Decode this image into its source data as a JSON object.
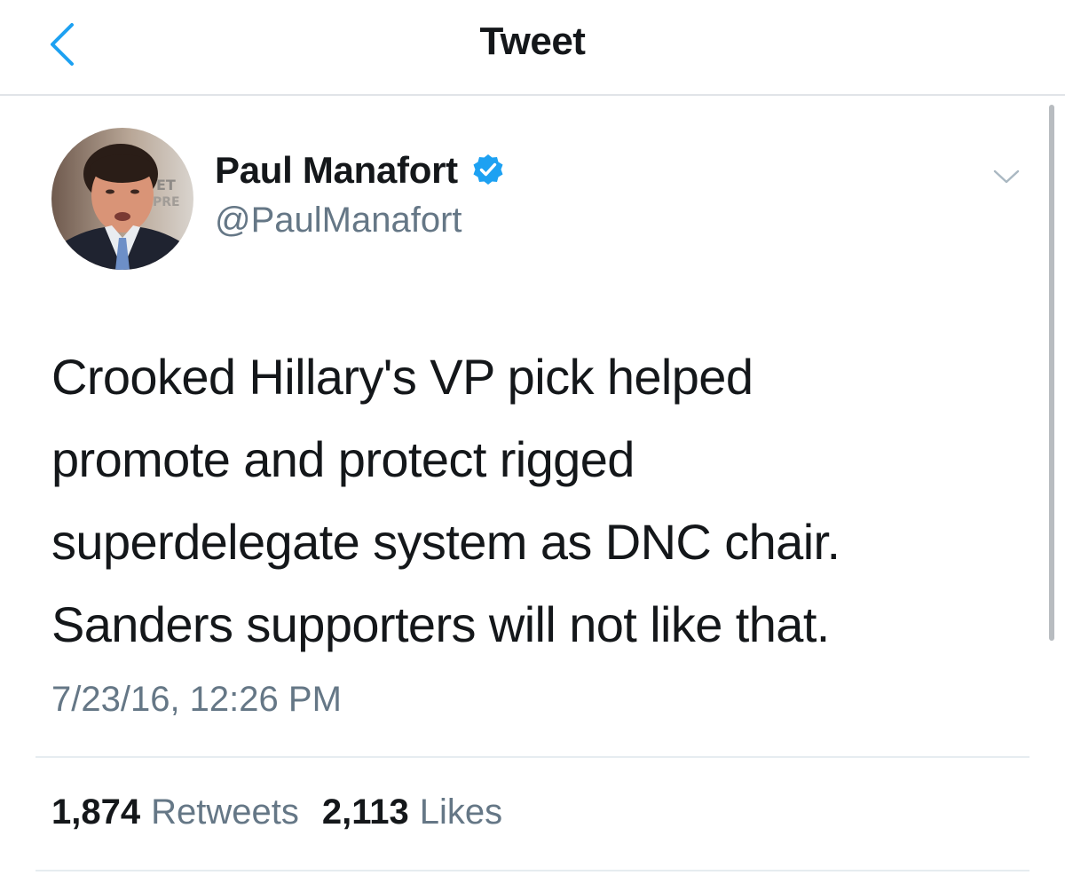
{
  "header": {
    "title": "Tweet",
    "back_icon": "chevron-left-icon"
  },
  "author": {
    "name": "Paul Manafort",
    "handle": "@PaulManafort",
    "verified": true
  },
  "tweet": {
    "text": "Crooked Hillary's VP pick helped\npromote and protect rigged\nsuperdelegate system as DNC chair.\nSanders supporters will not like that.",
    "timestamp": "7/23/16, 12:26 PM"
  },
  "stats": {
    "retweets_count": "1,874",
    "retweets_label": "Retweets",
    "likes_count": "2,113",
    "likes_label": "Likes"
  },
  "colors": {
    "accent": "#1da1f2",
    "text_primary": "#14171a",
    "text_secondary": "#657786",
    "divider": "#e6ecf0"
  }
}
